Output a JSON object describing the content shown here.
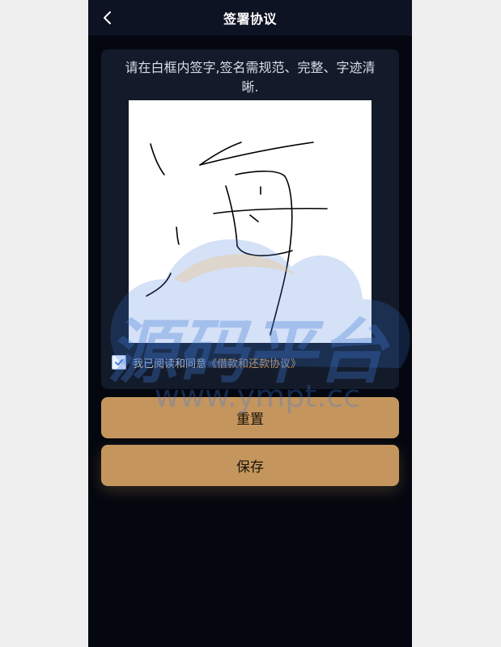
{
  "header": {
    "title": "签署协议",
    "back_icon": "chevron-left-icon"
  },
  "signature": {
    "instruction": "请在白框内签字,签名需规范、完整、字迹清晰."
  },
  "agreement": {
    "checked": true,
    "prefix": "我已阅读和同意",
    "link_text": "《借款和还款协议》"
  },
  "buttons": {
    "reset_label": "重置",
    "save_label": "保存"
  },
  "watermark": {
    "brand_text": "源码平台",
    "url_text": "www.ympt.cc"
  },
  "colors": {
    "accent_gold": "#c4965e",
    "page_bg": "#04070f",
    "card_bg": "#131b2a",
    "header_bg": "#0d1322"
  }
}
